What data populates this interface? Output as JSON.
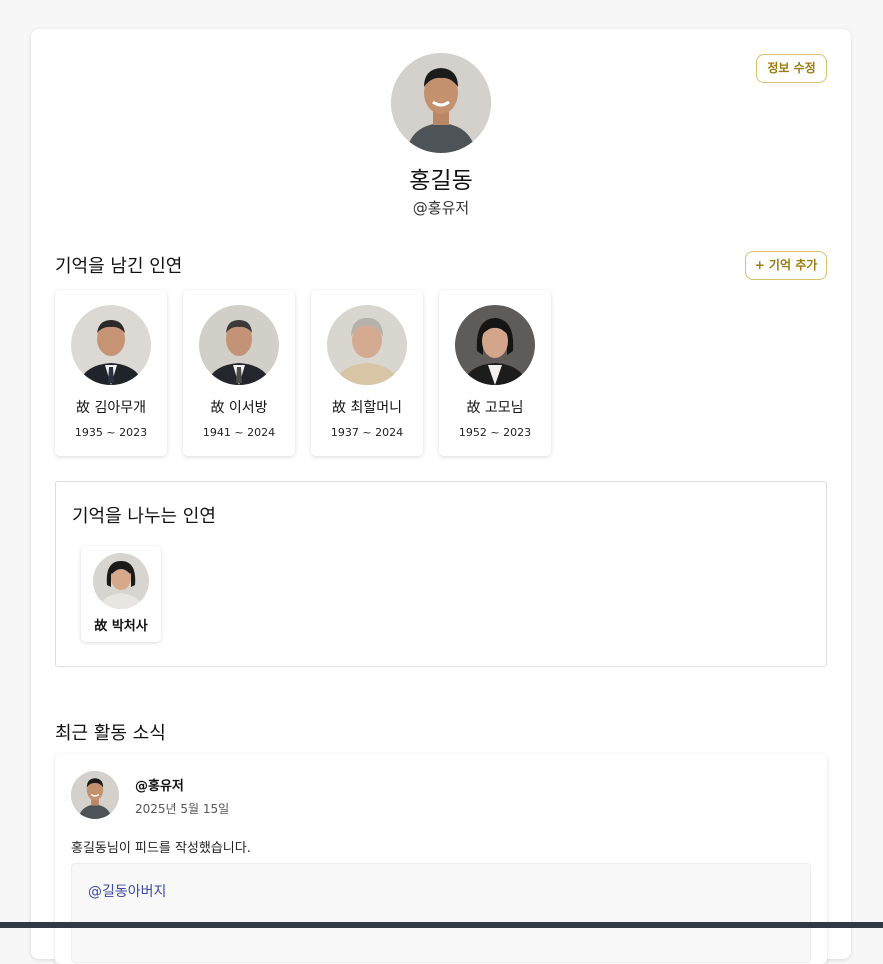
{
  "profile": {
    "name": "홍길동",
    "handle": "@홍유저",
    "edit_button": "정보 수정",
    "avatar_icon": "profile-photo-young-man"
  },
  "memories": {
    "title": "기억을 남긴 인연",
    "add_button": "+ 기억 추가",
    "people": [
      {
        "name": "故 김아무개",
        "years": "1935 ~ 2023"
      },
      {
        "name": "故 이서방",
        "years": "1941 ~ 2024"
      },
      {
        "name": "故 최할머니",
        "years": "1937 ~ 2024"
      },
      {
        "name": "故 고모님",
        "years": "1952 ~ 2023"
      }
    ]
  },
  "sharing": {
    "title": "기억을 나누는 인연",
    "people": [
      {
        "name": "故 박처사"
      }
    ]
  },
  "activity": {
    "title": "최근 활동 소식",
    "feed": [
      {
        "user": "@홍유저",
        "date": "2025년 5월 15일",
        "text": "홍길동님이 피드를 작성했습니다.",
        "mention": "@길동아버지"
      }
    ]
  },
  "colors": {
    "accent": "#9a7b10",
    "accent_border": "#d8c16a",
    "mention": "#3b4aa5"
  }
}
